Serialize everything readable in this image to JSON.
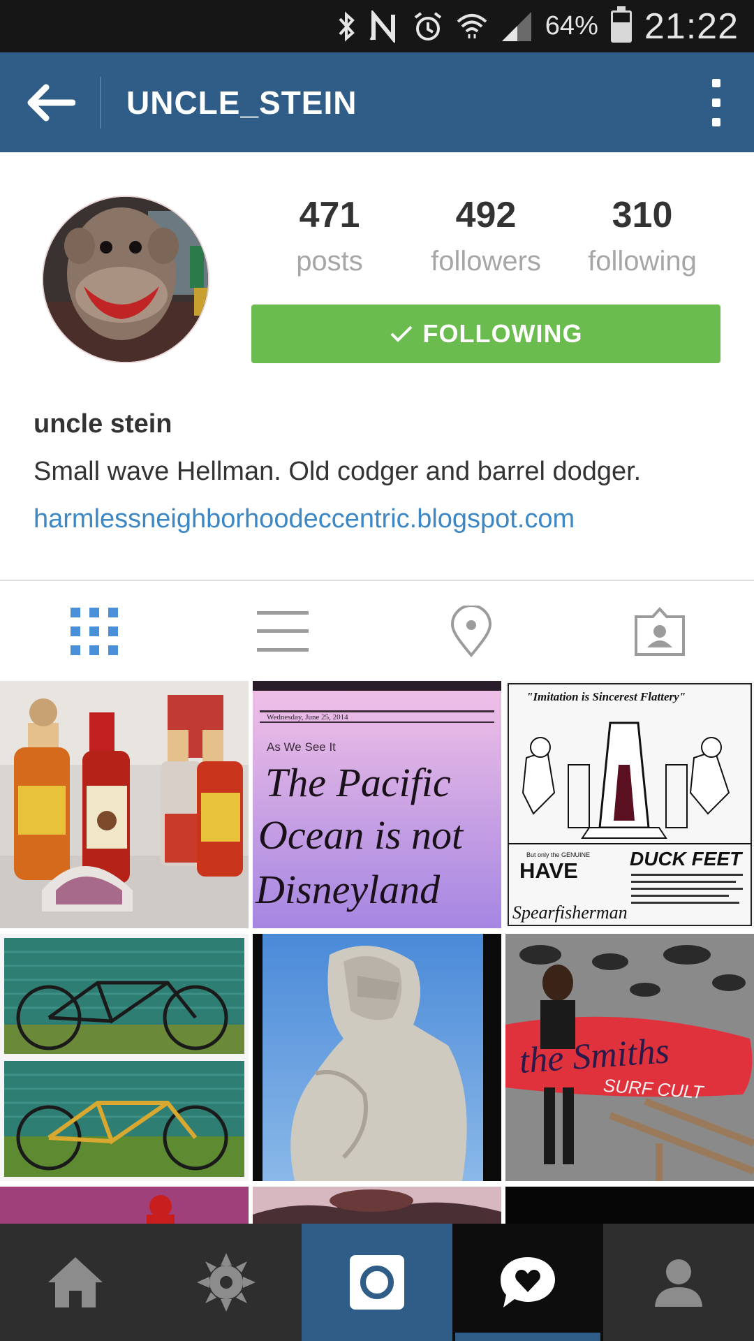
{
  "status_bar": {
    "icons": [
      "bluetooth-icon",
      "nfc-icon",
      "alarm-icon",
      "wifi-icon",
      "signal-icon",
      "battery-icon"
    ],
    "battery_percent": "64%",
    "battery_level": 0.64,
    "time": "21:22"
  },
  "app_bar": {
    "title": "UNCLE_STEIN",
    "back_icon": "arrow-left-icon",
    "menu_icon": "overflow-menu-icon",
    "color": "#2f5d87"
  },
  "profile": {
    "stats": [
      {
        "value": "471",
        "label": "posts"
      },
      {
        "value": "492",
        "label": "followers"
      },
      {
        "value": "310",
        "label": "following"
      }
    ],
    "follow_button": {
      "label": "FOLLOWING",
      "icon": "check-icon",
      "color": "#6bbc4f"
    },
    "full_name": "uncle stein",
    "bio": "Small wave Hellman. Old codger and barrel dodger.",
    "website": "harmlessneighborhoodeccentric.blogspot.com",
    "link_color": "#3d88c4"
  },
  "view_tabs": [
    {
      "icon": "grid-icon",
      "active": true
    },
    {
      "icon": "list-icon",
      "active": false
    },
    {
      "icon": "location-pin-icon",
      "active": false
    },
    {
      "icon": "tagged-photos-icon",
      "active": false
    }
  ],
  "photos": {
    "pacific": {
      "date_line": "Wednesday, June 25, 2014",
      "kicker": "As We See It",
      "headline_1": "The Pacific",
      "headline_2": "Ocean is not",
      "headline_3": "Disneyland"
    },
    "ad": {
      "quote": "\"Imitation is Sincerest Flattery\"",
      "small": "But only the GENUINE",
      "have": "HAVE",
      "duck_feet": "DUCK FEET",
      "maker": "Spearfisherman"
    },
    "surf": {
      "board_text": "the Smiths",
      "board_sub": "SURF CULT"
    }
  },
  "bottom_nav": [
    {
      "icon": "home-icon",
      "active": false
    },
    {
      "icon": "explore-icon",
      "active": false
    },
    {
      "icon": "camera-icon",
      "active": false
    },
    {
      "icon": "news-heart-icon",
      "active": true
    },
    {
      "icon": "profile-icon",
      "active": false
    }
  ]
}
